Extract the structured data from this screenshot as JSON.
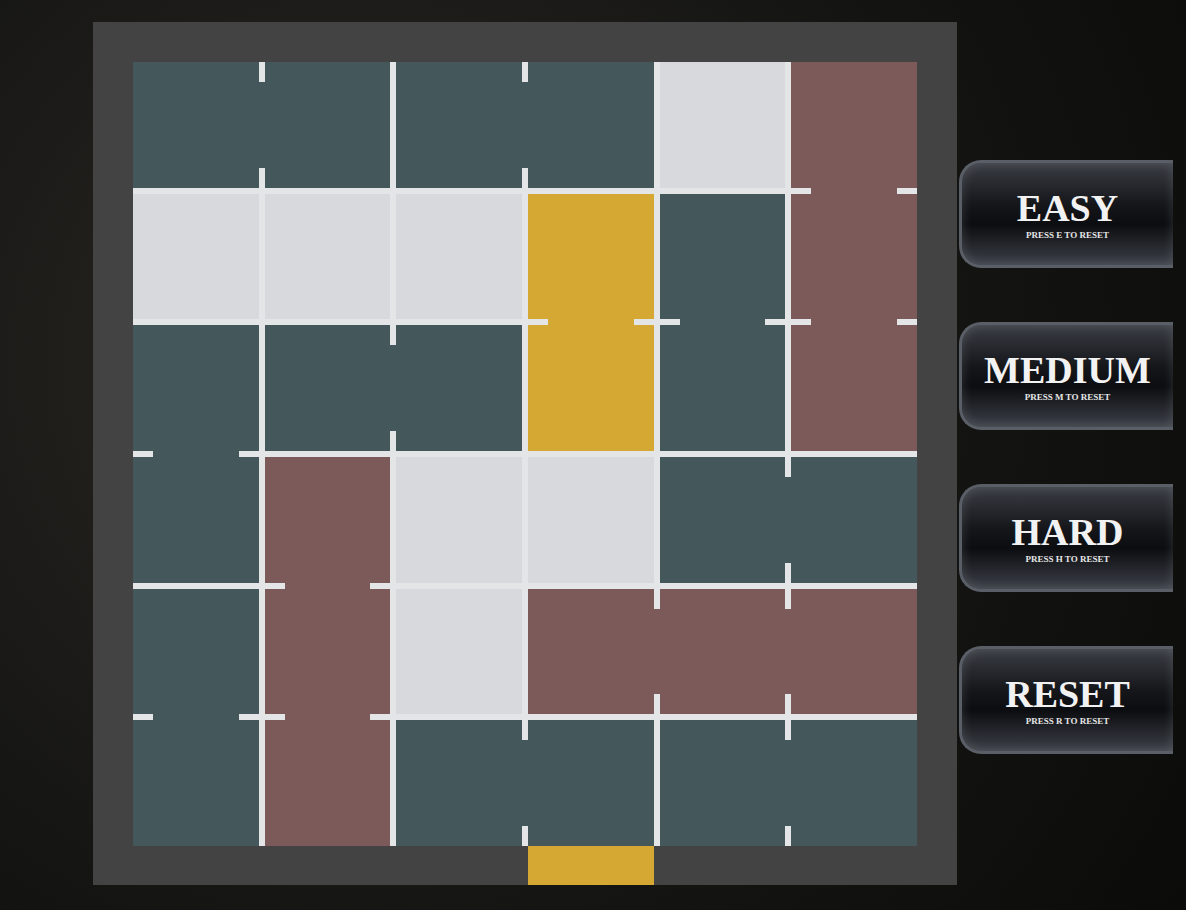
{
  "board": {
    "cols": 6,
    "rows": 6,
    "pieces": [
      {
        "col": 0,
        "row": 0,
        "w": 2,
        "h": 1,
        "color": "#44585b",
        "kind": "blocker"
      },
      {
        "col": 2,
        "row": 0,
        "w": 2,
        "h": 1,
        "color": "#44585b",
        "kind": "blocker"
      },
      {
        "col": 5,
        "row": 0,
        "w": 1,
        "h": 3,
        "color": "#7b5a59",
        "kind": "blocker"
      },
      {
        "col": 3,
        "row": 1,
        "w": 1,
        "h": 2,
        "color": "#d4a832",
        "kind": "target"
      },
      {
        "col": 4,
        "row": 1,
        "w": 1,
        "h": 2,
        "color": "#44585b",
        "kind": "blocker"
      },
      {
        "col": 0,
        "row": 2,
        "w": 1,
        "h": 2,
        "color": "#44585b",
        "kind": "blocker"
      },
      {
        "col": 1,
        "row": 2,
        "w": 2,
        "h": 1,
        "color": "#44585b",
        "kind": "blocker"
      },
      {
        "col": 1,
        "row": 3,
        "w": 1,
        "h": 3,
        "color": "#7b5a59",
        "kind": "blocker"
      },
      {
        "col": 4,
        "row": 3,
        "w": 2,
        "h": 1,
        "color": "#44585b",
        "kind": "blocker"
      },
      {
        "col": 0,
        "row": 4,
        "w": 1,
        "h": 2,
        "color": "#44585b",
        "kind": "blocker"
      },
      {
        "col": 3,
        "row": 4,
        "w": 3,
        "h": 1,
        "color": "#7b5a59",
        "kind": "blocker"
      },
      {
        "col": 2,
        "row": 5,
        "w": 2,
        "h": 1,
        "color": "#44585b",
        "kind": "blocker"
      },
      {
        "col": 4,
        "row": 5,
        "w": 2,
        "h": 1,
        "color": "#44585b",
        "kind": "blocker"
      }
    ],
    "exit": {
      "col": 3,
      "color": "#d4a832"
    }
  },
  "buttons": [
    {
      "label": "EASY",
      "hint": "PRESS E TO RESET"
    },
    {
      "label": "MEDIUM",
      "hint": "PRESS M TO RESET"
    },
    {
      "label": "HARD",
      "hint": "PRESS H TO RESET"
    },
    {
      "label": "RESET",
      "hint": "PRESS R TO RESET"
    }
  ]
}
